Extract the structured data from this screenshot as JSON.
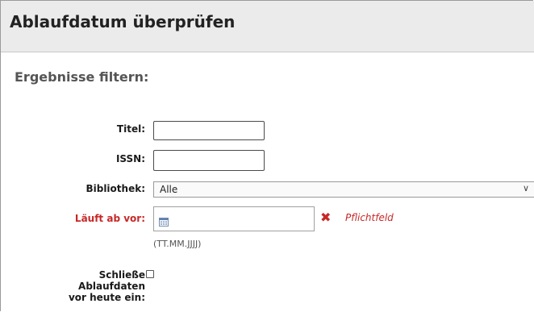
{
  "page": {
    "title": "Ablaufdatum überprüfen",
    "section_heading": "Ergebnisse filtern:"
  },
  "form": {
    "title_label": "Titel:",
    "title_value": "",
    "issn_label": "ISSN:",
    "issn_value": "",
    "library_label": "Bibliothek:",
    "library_selected": "Alle",
    "expires_label": "Läuft ab vor:",
    "expires_value": "",
    "required_text": "Pflichtfeld",
    "date_hint": "(TT.MM.JJJJ)",
    "include_label_line1": "Schließe",
    "include_label_line2": "Ablaufdaten",
    "include_label_line3": "vor heute ein:",
    "include_checked": false
  },
  "colors": {
    "required": "#c82828",
    "titlebar": "#ebebeb"
  }
}
